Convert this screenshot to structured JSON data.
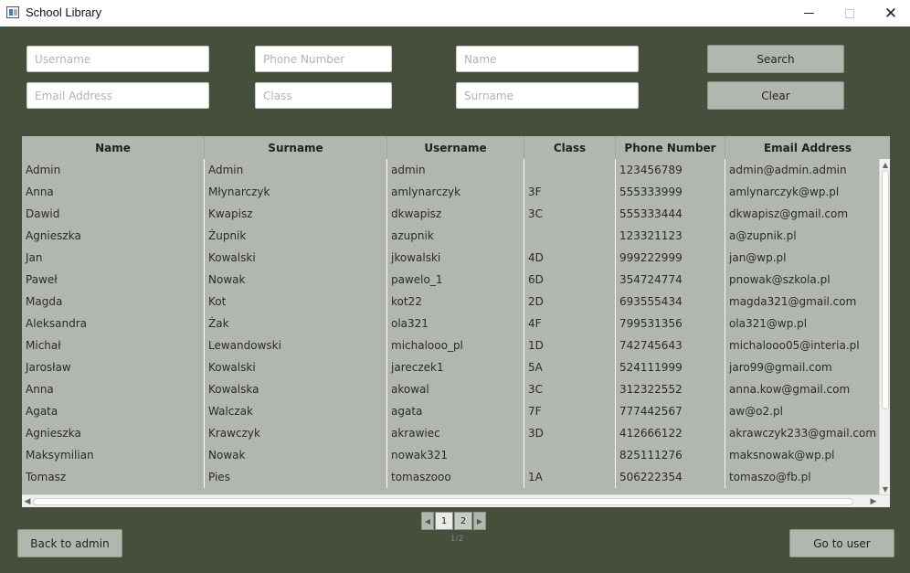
{
  "window": {
    "title": "School Library"
  },
  "search": {
    "username_placeholder": "Username",
    "phone_placeholder": "Phone Number",
    "name_placeholder": "Name",
    "email_placeholder": "Email Address",
    "class_placeholder": "Class",
    "surname_placeholder": "Surname",
    "search_label": "Search",
    "clear_label": "Clear"
  },
  "table": {
    "columns": [
      "Name",
      "Surname",
      "Username",
      "Class",
      "Phone Number",
      "Email Address"
    ],
    "rows": [
      [
        "Admin",
        "Admin",
        "admin",
        "",
        "123456789",
        "admin@admin.admin"
      ],
      [
        "Anna",
        "Młynarczyk",
        "amlynarczyk",
        "3F",
        "555333999",
        "amlynarczyk@wp.pl"
      ],
      [
        "Dawid",
        "Kwapisz",
        "dkwapisz",
        "3C",
        "555333444",
        "dkwapisz@gmail.com"
      ],
      [
        "Agnieszka",
        "Żupnik",
        "azupnik",
        "",
        "123321123",
        "a@zupnik.pl"
      ],
      [
        "Jan",
        "Kowalski",
        "jkowalski",
        "4D",
        "999222999",
        "jan@wp.pl"
      ],
      [
        "Paweł",
        "Nowak",
        "pawelo_1",
        "6D",
        "354724774",
        "pnowak@szkola.pl"
      ],
      [
        "Magda",
        "Kot",
        "kot22",
        "2D",
        "693555434",
        "magda321@gmail.com"
      ],
      [
        "Aleksandra",
        "Żak",
        "ola321",
        "4F",
        "799531356",
        "ola321@wp.pl"
      ],
      [
        "Michał",
        "Lewandowski",
        "michalooo_pl",
        "1D",
        "742745643",
        "michalooo05@interia.pl"
      ],
      [
        "Jarosław",
        "Kowalski",
        "jareczek1",
        "5A",
        "524111999",
        "jaro99@gmail.com"
      ],
      [
        "Anna",
        "Kowalska",
        "akowal",
        "3C",
        "312322552",
        "anna.kow@gmail.com"
      ],
      [
        "Agata",
        "Walczak",
        "agata",
        "7F",
        "777442567",
        "aw@o2.pl"
      ],
      [
        "Agnieszka",
        "Krawczyk",
        "akrawiec",
        "3D",
        "412666122",
        "akrawczyk233@gmail.com"
      ],
      [
        "Maksymilian",
        "Nowak",
        "nowak321",
        "",
        "825111276",
        "maksnowak@wp.pl"
      ],
      [
        "Tomasz",
        "Pies",
        "tomaszooo",
        "1A",
        "506222354",
        "tomaszo@fb.pl"
      ]
    ]
  },
  "pagination": {
    "pages": [
      "1",
      "2"
    ],
    "current": "1",
    "info": "1/2"
  },
  "footer": {
    "back_label": "Back to admin",
    "user_label": "Go to user"
  },
  "colors": {
    "background": "#464f3b",
    "table": "#b1b6ae",
    "button": "#b1b6ae"
  }
}
